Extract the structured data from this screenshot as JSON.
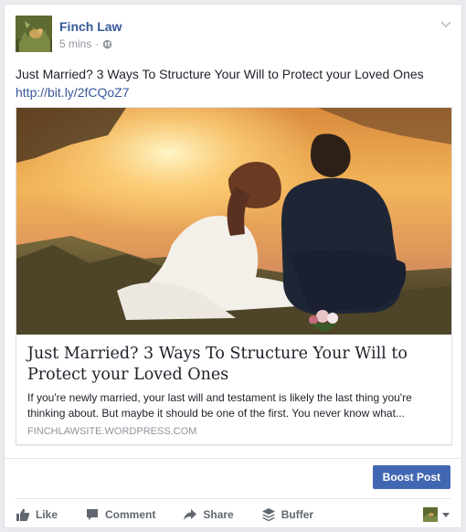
{
  "post": {
    "author": "Finch Law",
    "time": "5 mins",
    "separator": "·",
    "text": "Just Married? 3 Ways To Structure Your Will to Protect your Loved Ones",
    "link": "http://bit.ly/2fCQoZ7"
  },
  "preview": {
    "title": "Just Married? 3 Ways To Structure Your Will to Protect your Loved Ones",
    "description": "If you're newly married, your last will and testament is likely the last thing you're thinking about. But maybe it should be one of the first. You never know what...",
    "domain": "FINCHLAWSITE.WORDPRESS.COM"
  },
  "boost": {
    "label": "Boost Post"
  },
  "actions": {
    "like": "Like",
    "comment": "Comment",
    "share": "Share",
    "buffer": "Buffer"
  },
  "colors": {
    "link": "#365899",
    "boost": "#4267b2",
    "muted": "#90949c",
    "action": "#606770"
  }
}
